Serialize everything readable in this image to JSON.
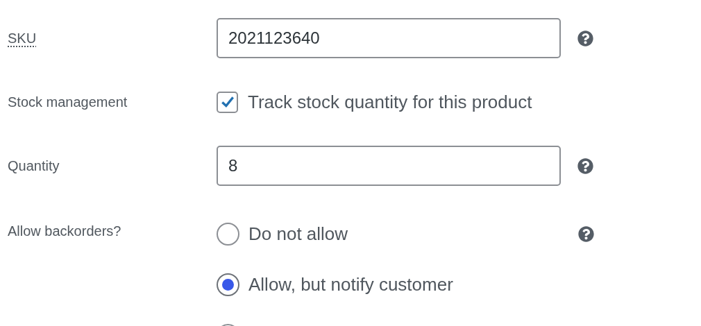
{
  "sku": {
    "label": "SKU",
    "value": "2021123640",
    "help": true
  },
  "stock_management": {
    "label": "Stock management",
    "checkbox_label": "Track stock quantity for this product",
    "checked": true
  },
  "quantity": {
    "label": "Quantity",
    "value": "8",
    "help": true
  },
  "backorders": {
    "label": "Allow backorders?",
    "help": true,
    "options": [
      {
        "label": "Do not allow",
        "selected": false
      },
      {
        "label": "Allow, but notify customer",
        "selected": true
      },
      {
        "selected": false
      }
    ]
  }
}
